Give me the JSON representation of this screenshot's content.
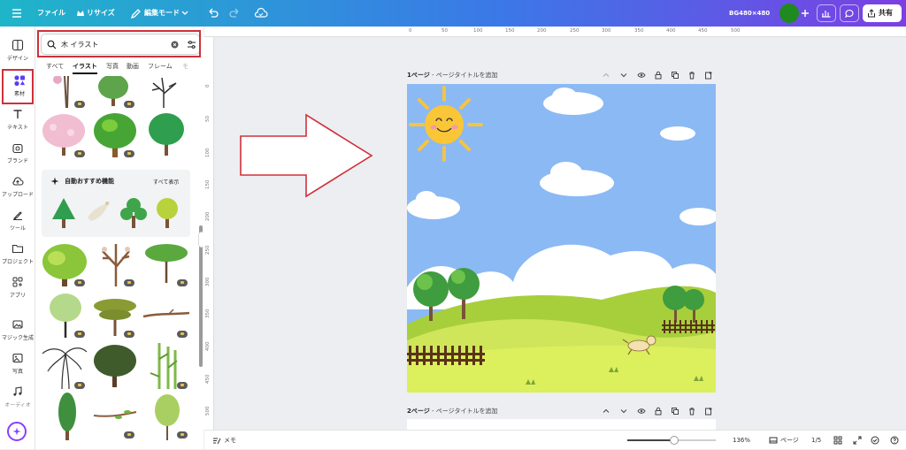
{
  "topbar": {
    "menu": [
      "ファイル",
      "リサイズ",
      "編集モード"
    ],
    "design_name": "BG480×480",
    "share_label": "共有"
  },
  "rail": {
    "items": [
      "デザイン",
      "素材",
      "テキスト",
      "ブランド",
      "アップロード",
      "ツール",
      "プロジェクト",
      "アプリ",
      "マジック生成",
      "写真",
      "オーディオ"
    ]
  },
  "panel": {
    "search_query": "木 イラスト",
    "tabs": [
      "すべて",
      "イラスト",
      "写真",
      "動画",
      "フレーム",
      "モ"
    ],
    "suggest_title": "自動おすすめ機能",
    "suggest_link": "すべて表示"
  },
  "ruler": {
    "x_ticks": [
      "0",
      "50",
      "100",
      "150",
      "200",
      "250",
      "300",
      "350",
      "400",
      "450",
      "500"
    ],
    "y_ticks": [
      "0",
      "50",
      "100",
      "150",
      "200",
      "250",
      "300",
      "350",
      "400",
      "450",
      "500"
    ]
  },
  "pages": [
    {
      "label": "1ページ",
      "title_placeholder": "ページタイトルを追加"
    },
    {
      "label": "2ページ",
      "title_placeholder": "ページタイトルを追加"
    }
  ],
  "bottombar": {
    "notes_label": "メモ",
    "zoom": "136%",
    "pages_label": "ページ",
    "page_count": "1/5",
    "zoom_fraction": 0.53
  },
  "colors": {
    "accent": "#8b3dff",
    "highlight": "#d0303a",
    "sky": "#8bb9f4",
    "grass": "#a8d43a"
  }
}
